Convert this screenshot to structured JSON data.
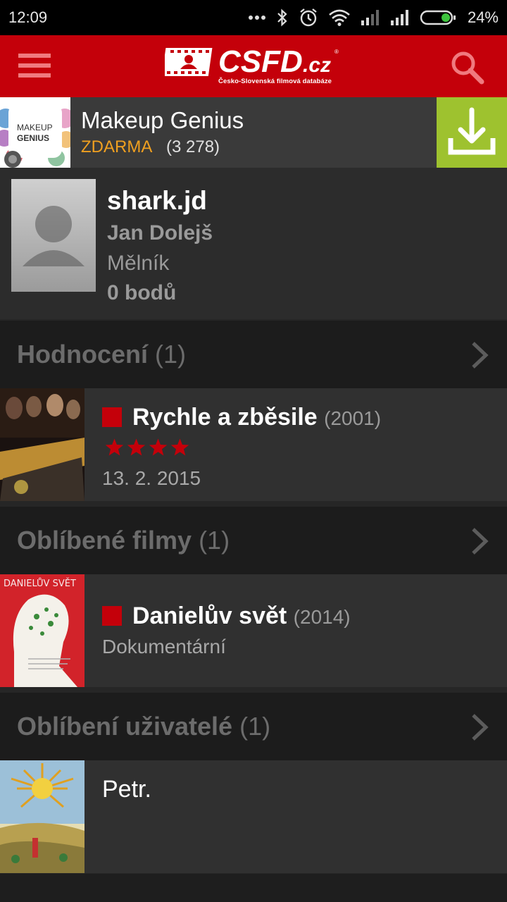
{
  "status_bar": {
    "time": "12:09",
    "battery_percent": "24%",
    "icons": [
      "more-dots-icon",
      "bluetooth-icon",
      "alarm-icon",
      "wifi-icon",
      "signal-icon",
      "signal-icon",
      "battery-icon"
    ]
  },
  "app_bar": {
    "logo_text": "CSFD.cz",
    "logo_tagline": "Česko-Slovenská filmová databáze",
    "menu_icon": "hamburger-menu-icon",
    "search_icon": "search-icon"
  },
  "ad": {
    "icon_text_top": "MAKEUP",
    "icon_text_bottom": "GENIUS",
    "title": "Makeup Genius",
    "price": "ZDARMA",
    "rating_count": "(3 278)",
    "install_icon": "download-icon"
  },
  "profile": {
    "username": "shark.jd",
    "real_name": "Jan Dolejš",
    "city": "Mělník",
    "points": "0 bodů"
  },
  "sections": [
    {
      "title": "Hodnocení",
      "count": "(1)",
      "item": {
        "title": "Rychle a zběsile",
        "year": "(2001)",
        "stars": 4,
        "date": "13. 2. 2015"
      }
    },
    {
      "title": "Oblíbené filmy",
      "count": "(1)",
      "item": {
        "title": "Danielův svět",
        "year": "(2014)",
        "genre": "Dokumentární",
        "poster_text": "DANIELŮV SVĚT"
      }
    },
    {
      "title": "Oblíbení uživatelé",
      "count": "(1)",
      "item": {
        "name": "Petr."
      }
    }
  ],
  "colors": {
    "brand_red": "#c4000a",
    "install_green": "#9ec22f",
    "price_orange": "#f0a020"
  }
}
